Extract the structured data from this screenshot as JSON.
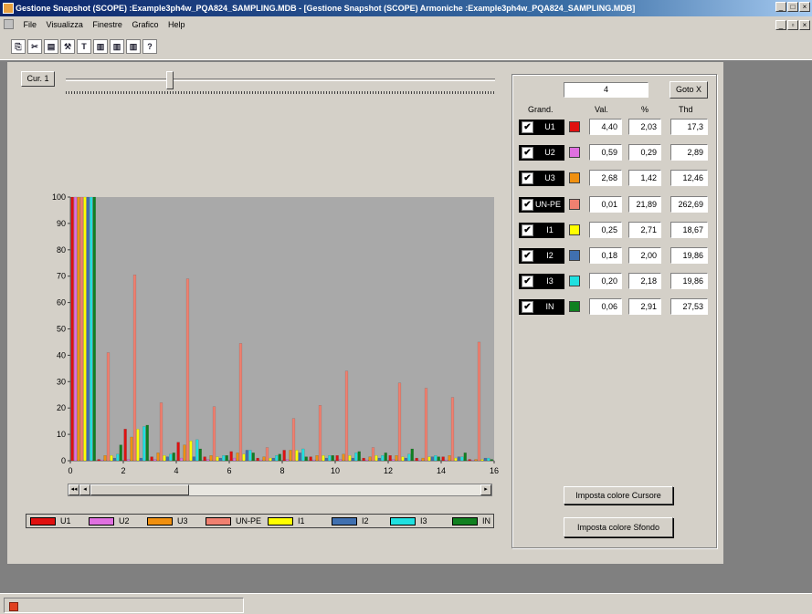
{
  "window": {
    "title": "Gestione Snapshot (SCOPE) :Example3ph4w_PQA824_SAMPLING.MDB - [Gestione Snapshot (SCOPE) Armoniche :Example3ph4w_PQA824_SAMPLING.MDB]"
  },
  "menu": [
    "File",
    "Visualizza",
    "Finestre",
    "Grafico",
    "Help"
  ],
  "toolbar": {
    "buttons": [
      "copy-button",
      "cut-button",
      "paste-button",
      "tools-button",
      "text-button",
      "chart1-button",
      "chart2-button",
      "chart3-button",
      "help-button"
    ],
    "text_glyph": "T"
  },
  "cursor": {
    "button_label": "Cur. 1",
    "position": 4,
    "goto_label": "Goto X"
  },
  "table": {
    "headers": {
      "grand": "Grand.",
      "val": "Val.",
      "pct": "%",
      "thd": "Thd"
    },
    "rows": [
      {
        "name": "U1",
        "color": "#e01010",
        "val": "4,40",
        "pct": "2,03",
        "thd": "17,3"
      },
      {
        "name": "U2",
        "color": "#e070e0",
        "val": "0,59",
        "pct": "0,29",
        "thd": "2,89"
      },
      {
        "name": "U3",
        "color": "#f09010",
        "val": "2,68",
        "pct": "1,42",
        "thd": "12,46"
      },
      {
        "name": "UN-PE",
        "color": "#f08070",
        "val": "0,01",
        "pct": "21,89",
        "thd": "262,69"
      },
      {
        "name": "I1",
        "color": "#ffff00",
        "val": "0,25",
        "pct": "2,71",
        "thd": "18,67"
      },
      {
        "name": "I2",
        "color": "#4070b0",
        "val": "0,18",
        "pct": "2,00",
        "thd": "19,86"
      },
      {
        "name": "I3",
        "color": "#20e0e0",
        "val": "0,20",
        "pct": "2,18",
        "thd": "19,86"
      },
      {
        "name": "IN",
        "color": "#108020",
        "val": "0,06",
        "pct": "2,91",
        "thd": "27,53"
      }
    ]
  },
  "buttons": {
    "cursor_color": "Imposta colore Cursore",
    "background_color": "Imposta colore Sfondo"
  },
  "chart_data": {
    "type": "bar",
    "x_ticks": [
      "0",
      "2",
      "4",
      "6",
      "8",
      "10",
      "12",
      "14",
      "16"
    ],
    "y_ticks": [
      "0",
      "10",
      "20",
      "30",
      "40",
      "50",
      "60",
      "70",
      "80",
      "90",
      "100"
    ],
    "ylim": [
      0,
      100
    ],
    "xlim": [
      0,
      16
    ],
    "grid": false,
    "legend_position": "bottom",
    "categories": [
      "1",
      "2",
      "3",
      "4",
      "5",
      "6",
      "7",
      "8",
      "9",
      "10",
      "11",
      "12",
      "13",
      "14",
      "15",
      "16"
    ],
    "series": [
      {
        "name": "U1",
        "color": "#e01010",
        "values": [
          100,
          0.5,
          12,
          1.5,
          7,
          1.5,
          3.5,
          1,
          4,
          1.5,
          2,
          1,
          2,
          1,
          1.5,
          0.5
        ]
      },
      {
        "name": "U2",
        "color": "#e070e0",
        "values": [
          100,
          0.3,
          0.5,
          0.5,
          1,
          0.5,
          1,
          0.3,
          0.5,
          0.3,
          0.5,
          0.3,
          0.5,
          0.3,
          0.3,
          0.2
        ]
      },
      {
        "name": "U3",
        "color": "#f09010",
        "values": [
          100,
          2,
          9,
          3,
          6,
          2,
          3,
          1.5,
          4,
          2,
          2.5,
          1.5,
          2,
          1,
          2,
          0.5
        ]
      },
      {
        "name": "UN-PE",
        "color": "#f08070",
        "values": [
          100,
          41,
          70.5,
          22,
          69,
          20.5,
          44.5,
          5,
          16,
          21,
          34,
          5,
          29.5,
          27.5,
          24,
          45
        ]
      },
      {
        "name": "I1",
        "color": "#ffff00",
        "values": [
          100,
          2,
          12,
          2,
          7.5,
          1.5,
          2.5,
          1,
          4,
          2,
          2,
          2,
          1.5,
          1.5,
          1,
          0.5
        ]
      },
      {
        "name": "I2",
        "color": "#4070b0",
        "values": [
          100,
          1,
          1,
          1.5,
          1.5,
          1,
          4,
          1,
          3,
          1,
          1,
          1,
          1,
          1.5,
          1.5,
          1
        ]
      },
      {
        "name": "I3",
        "color": "#20e0e0",
        "values": [
          100,
          2.5,
          13,
          2.5,
          8,
          2,
          4,
          2,
          4.5,
          2,
          3,
          2,
          2.5,
          2,
          1.5,
          1
        ]
      },
      {
        "name": "IN",
        "color": "#108020",
        "values": [
          100,
          6,
          13.5,
          3,
          4.5,
          2,
          3,
          2.5,
          1.5,
          2,
          3.5,
          3,
          4.5,
          1.5,
          3,
          0.5
        ]
      }
    ]
  }
}
